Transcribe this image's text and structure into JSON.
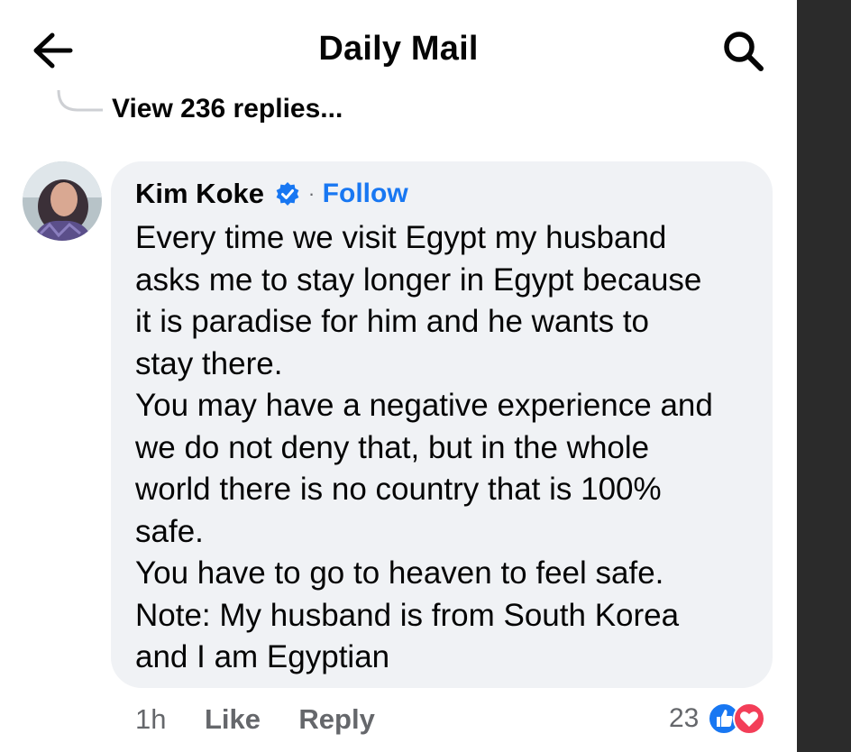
{
  "header": {
    "title": "Daily Mail",
    "back_icon": "arrow-left-icon",
    "search_icon": "search-icon"
  },
  "thread": {
    "view_replies": "View 236 replies..."
  },
  "comment": {
    "author": "Kim Koke",
    "separator": "·",
    "follow": "Follow",
    "lines": [
      "Every time we visit Egypt my husband",
      "asks me to stay longer in Egypt because",
      "it is paradise for him and he wants to",
      "stay there.",
      "You may have a negative experience and",
      "we do not deny that, but in the whole",
      "world there is no country that is 100%",
      "safe.",
      "You have to go to heaven to feel safe.",
      "Note: My husband is from South Korea",
      "and I am Egyptian"
    ],
    "time": "1h",
    "like": "Like",
    "reply": "Reply",
    "reaction_count": "23",
    "reaction_icons": [
      "like-reaction-icon",
      "love-reaction-icon"
    ]
  },
  "colors": {
    "accent": "#1877f2",
    "bubble": "#f0f2f5",
    "muted": "#65676b",
    "love": "#f33e58"
  }
}
